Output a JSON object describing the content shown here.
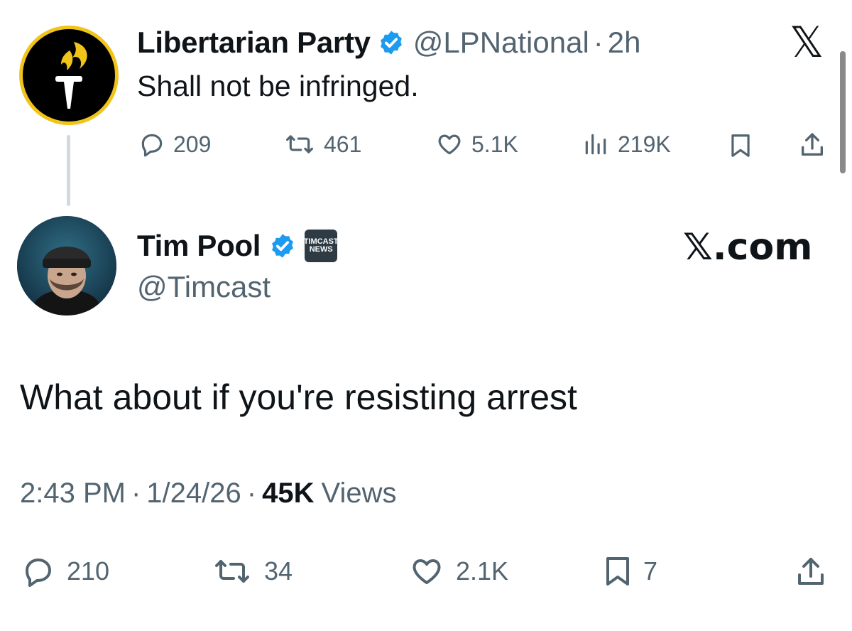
{
  "parent_tweet": {
    "author_name": "Libertarian Party",
    "handle": "@LPNational",
    "separator": "·",
    "time_ago": "2h",
    "text": "Shall not be infringed.",
    "actions": {
      "replies": "209",
      "reposts": "461",
      "likes": "5.1K",
      "views": "219K"
    },
    "platform_logo": "𝕏"
  },
  "reply_tweet": {
    "author_name": "Tim Pool",
    "badge": [
      "TIMCAST",
      "NEWS"
    ],
    "handle": "@Timcast",
    "text": "What about if you're resisting arrest",
    "meta": {
      "time": "2:43 PM",
      "separator": "·",
      "date": "1/24/26",
      "views_count": "45K",
      "views_label": "Views"
    },
    "actions": {
      "replies": "210",
      "reposts": "34",
      "likes": "2.1K",
      "bookmarks": "7"
    }
  },
  "watermark": "𝕏.com",
  "colors": {
    "text": "#0f1419",
    "secondary_text": "#536471",
    "verified_blue": "#1d9bf0",
    "lp_gold": "#f0c419",
    "thread_line": "#cfd9de"
  }
}
